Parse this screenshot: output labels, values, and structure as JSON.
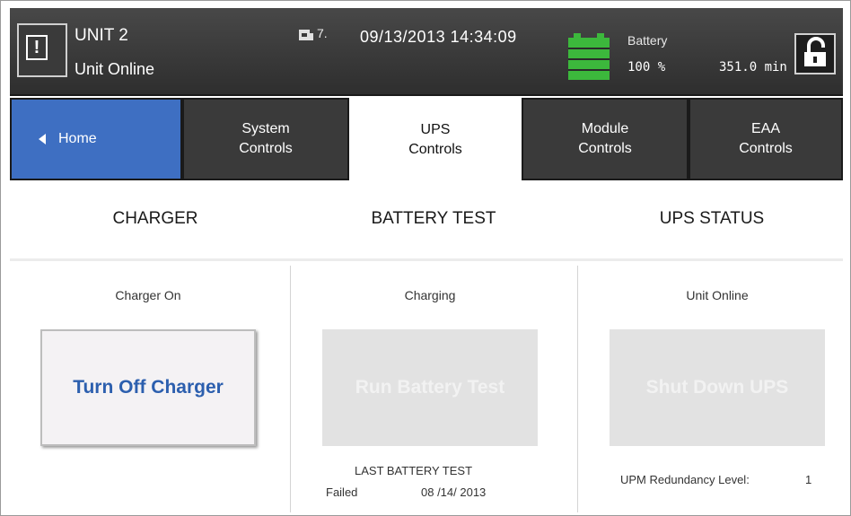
{
  "header": {
    "unit_name": "UNIT 2",
    "unit_status": "Unit Online",
    "notice_mark": "?",
    "notice_suffix": "7.",
    "datetime": "09/13/2013 14:34:09",
    "battery_label": "Battery",
    "battery_percent": "100 %",
    "battery_minutes": "351.0 min",
    "battery_level": 1.0,
    "battery_color": "#3cb83c"
  },
  "tabs": [
    {
      "label_line1": "Home",
      "label_line2": ""
    },
    {
      "label_line1": "System",
      "label_line2": "Controls"
    },
    {
      "label_line1": "UPS",
      "label_line2": "Controls"
    },
    {
      "label_line1": "Module",
      "label_line2": "Controls"
    },
    {
      "label_line1": "EAA",
      "label_line2": "Controls"
    }
  ],
  "active_tab": "UPS Controls",
  "colors": {
    "home_tab": "#3e6fc2",
    "primary_button_text": "#2c5fae",
    "header_bg": "#3a3a3a"
  },
  "sections": {
    "charger": {
      "heading": "CHARGER",
      "status": "Charger On",
      "button": "Turn Off Charger"
    },
    "battery_test": {
      "heading": "BATTERY TEST",
      "status": "Charging",
      "button": "Run Battery Test",
      "last_test_label": "LAST BATTERY TEST",
      "last_test_result": "Failed",
      "last_test_date": "08 /14/ 2013"
    },
    "ups_status": {
      "heading": "UPS STATUS",
      "status": "Unit Online",
      "button": "Shut Down UPS",
      "redundancy_label": "UPM Redundancy Level:",
      "redundancy_value": "1"
    }
  }
}
